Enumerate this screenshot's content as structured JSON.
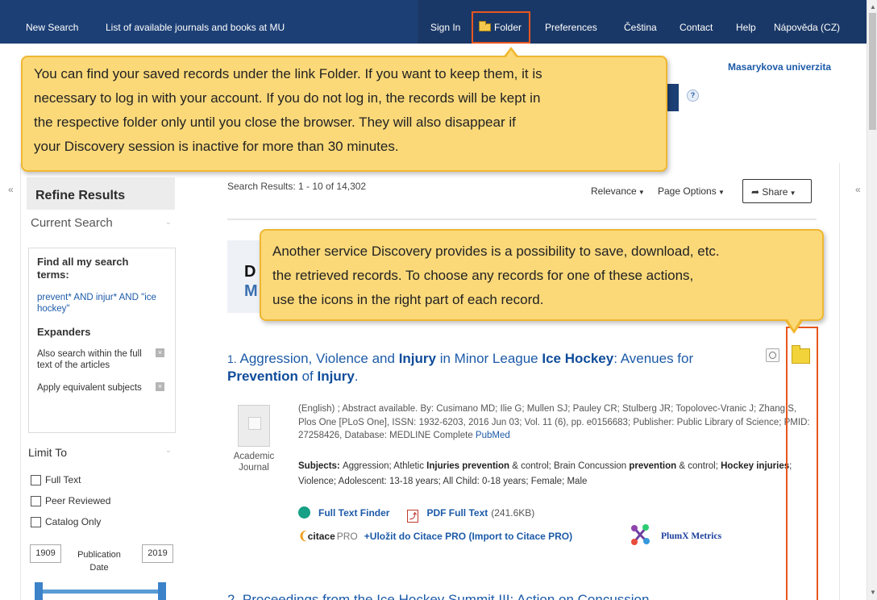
{
  "topnav": {
    "new_search": "New Search",
    "journals": "List of available journals and books at MU",
    "sign_in": "Sign In",
    "folder": "Folder",
    "preferences": "Preferences",
    "cestina": "Čeština",
    "contact": "Contact",
    "help": "Help",
    "napoveda": "Nápověda (CZ)"
  },
  "brand": "Masarykova univerzita",
  "help_q": "?",
  "tooltip_folder": [
    "You can find your saved records under the link Folder. If you want to keep them, it is",
    "necessary to log in with your account. If you do not log in, the records will be kept in",
    "the respective folder only until you close the browser. They will also disappear if",
    "your Discovery session is inactive for more than 30 minutes."
  ],
  "tooltip_actions": [
    "Another service Discovery provides is a possibility to save, download, etc.",
    "the retrieved records. To choose any records for one of these actions,",
    "use the icons in the right part of each record."
  ],
  "sidebar": {
    "refine": "Refine Results",
    "current_search": "Current Search",
    "find_all": "Find all my search terms:",
    "terms": "prevent* AND injur* AND \"ice hockey\"",
    "expanders": "Expanders",
    "expander_1": "Also search within the full text of the articles",
    "expander_2": "Apply equivalent subjects",
    "limit_to": "Limit To",
    "full_text": "Full Text",
    "peer_reviewed": "Peer Reviewed",
    "catalog_only": "Catalog Only",
    "year_from": "1909",
    "year_to": "2019",
    "pub_date": "Publication Date",
    "date_range_fraction": [
      0.0,
      1.0
    ]
  },
  "results": {
    "count": "Search Results: 1 - 10 of 14,302",
    "relevance": "Relevance",
    "page_options": "Page Options",
    "share": "Share",
    "disc_d": "D",
    "disc_m": "M"
  },
  "record1": {
    "number": "1.",
    "title_parts": [
      {
        "t": "Aggression, Violence and ",
        "b": false
      },
      {
        "t": "Injury",
        "b": true
      },
      {
        "t": " in Minor League ",
        "b": false
      },
      {
        "t": "Ice Hockey",
        "b": true
      },
      {
        "t": ": Avenues for ",
        "b": false
      },
      {
        "t": "Prevention",
        "b": true
      },
      {
        "t": " of ",
        "b": false
      },
      {
        "t": "Injury",
        "b": true
      },
      {
        "t": ".",
        "b": false
      }
    ],
    "doc_type": "Academic Journal",
    "meta": "(English) ; Abstract available. By: Cusimano MD; Ilie G; Mullen SJ; Pauley CR; Stulberg JR; Topolovec-Vranic J; Zhang S, Plos One [PLoS One], ISSN: 1932-6203, 2016 Jun 03; Vol. 11 (6), pp. e0156683; Publisher: Public Library of Science; PMID: 27258426, Database: MEDLINE Complete",
    "pubmed": "PubMed",
    "subjects_parts": [
      {
        "t": "Subjects: ",
        "b": true
      },
      {
        "t": "Aggression; Athletic ",
        "b": false
      },
      {
        "t": "Injuries prevention",
        "b": true
      },
      {
        "t": " & control; Brain Concussion ",
        "b": false
      },
      {
        "t": "prevention",
        "b": true
      },
      {
        "t": " & control; ",
        "b": false
      },
      {
        "t": "Hockey injuries",
        "b": true
      },
      {
        "t": "; Violence; Adolescent: 13-18 years; All Child: 0-18 years; Female; Male",
        "b": false
      }
    ],
    "full_text_finder": "Full Text Finder",
    "pdf_full_text": "PDF Full Text",
    "pdf_size": "(241.6KB)",
    "citace_logo": "citace",
    "citace_pro": "PRO",
    "citace_link": "+Uložit do Citace PRO (Import to Citace PRO)",
    "plumx": "PlumX Metrics"
  },
  "record2": {
    "title": "2. Proceedings from the Ice Hockey Summit III: Action on Concussion"
  },
  "colors": {
    "nav": "#1c3f75",
    "link": "#1c5aa8",
    "tooltip": "#fbd979",
    "highlight": "#e8561e"
  }
}
